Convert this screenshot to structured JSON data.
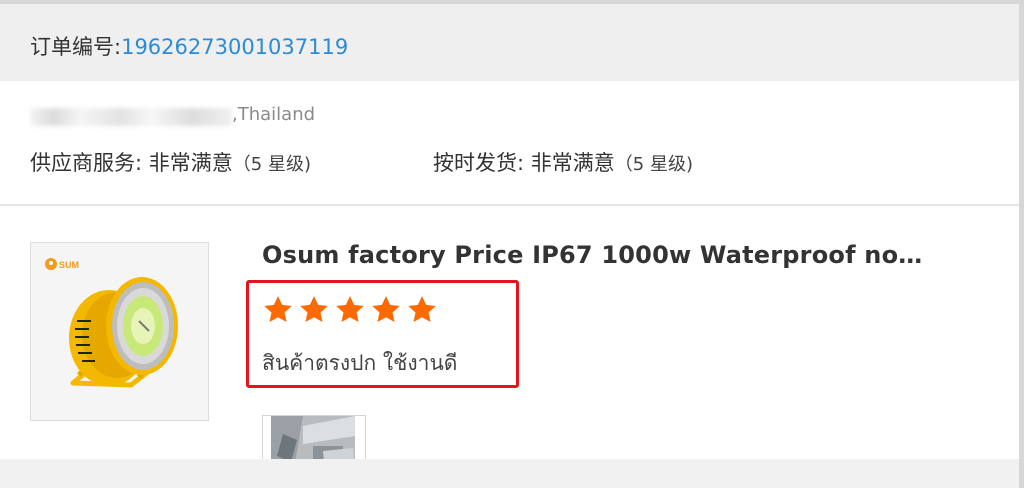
{
  "order": {
    "label": "订单编号:",
    "number": "19626273001037119"
  },
  "buyer": {
    "location": ",Thailand"
  },
  "ratings": {
    "supplier_label": "供应商服务: ",
    "supplier_value": "非常满意",
    "supplier_level": "（5 星级)",
    "shipping_label": "按时发货: ",
    "shipping_value": "非常满意",
    "shipping_level": "（5 星级)"
  },
  "product": {
    "brand": "SUM",
    "title": "Osum factory Price IP67 1000w Waterproof no…",
    "stars": 5,
    "review_text": "สินค้าตรงปก ใช้งานดี",
    "icon": "led-floodlight-image"
  },
  "colors": {
    "link": "#2a8bd8",
    "star": "#ff6a00",
    "highlight": "#e4141b",
    "product_yellow": "#f5b800"
  }
}
